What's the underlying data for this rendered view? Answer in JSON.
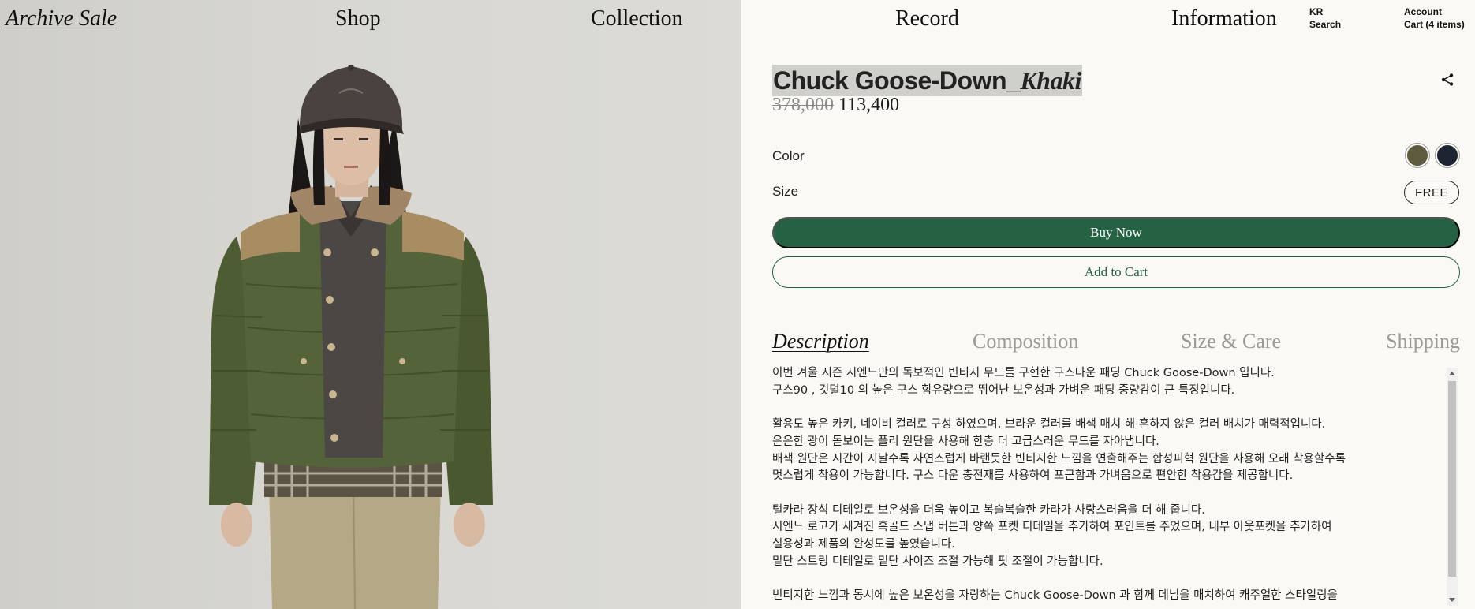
{
  "nav": {
    "archive_sale": "Archive Sale",
    "shop": "Shop",
    "collection": "Collection",
    "record": "Record",
    "information": "Information",
    "language": "KR",
    "search": "Search",
    "account": "Account",
    "cart": "Cart (4 items)"
  },
  "product": {
    "name": "Chuck Goose-Down_",
    "variant": "Khaki",
    "original_price": "378,000",
    "sale_price": "113,400",
    "color_label": "Color",
    "size_label": "Size",
    "size_value": "FREE",
    "swatches": [
      {
        "name": "khaki",
        "color": "#5e5b3f"
      },
      {
        "name": "navy",
        "color": "#1f2433"
      }
    ],
    "buy_now": "Buy Now",
    "add_to_cart": "Add to Cart"
  },
  "tabs": [
    {
      "label": "Description",
      "active": true
    },
    {
      "label": "Composition",
      "active": false
    },
    {
      "label": "Size & Care",
      "active": false
    },
    {
      "label": "Shipping",
      "active": false
    }
  ],
  "description": [
    "이번 겨울 시즌 시엔느만의 독보적인 빈티지 무드를 구현한 구스다운 패딩 Chuck Goose-Down 입니다.",
    "구스90 , 깃털10 의 높은 구스 함유량으로 뛰어난 보온성과 가벼운 패딩 중량감이 큰 특징입니다.",
    "",
    "활용도 높은 카키, 네이비 컬러로 구성 하였으며, 브라운 컬러를 배색 매치 해 흔하지 않은 컬러 배치가 매력적입니다.",
    "은은한 광이 돋보이는 폴리 원단을 사용해 한층 더 고급스러운 무드를 자아냅니다.",
    "배색 원단은 시간이 지날수록 자연스럽게 바랜듯한 빈티지한 느낌을 연출해주는 합성피혁 원단을 사용해 오래 착용할수록",
    "멋스럽게 착용이 가능합니다. 구스 다운 충전재를 사용하여 포근함과 가벼움으로 편안한 착용감을 제공합니다.",
    "",
    "털카라 장식 디테일로 보온성을 더욱 높이고 복슬복슬한 카라가 사랑스러움을 더 해 줍니다.",
    "시엔느 로고가 새겨진 흑골드 스냅 버튼과 양쪽 포켓 디테일을 추가하여 포인트를 주었으며, 내부 아웃포켓을 추가하여",
    "실용성과 제품의 완성도를 높였습니다.",
    "밑단 스트링 디테일로 밑단 사이즈 조절 가능해 핏 조절이 가능합니다.",
    "",
    "빈티지한 느낌과 동시에 높은 보온성을 자랑하는 Chuck Goose-Down 과 함께 데님을 매치하여 캐주얼한 스타일링을"
  ]
}
